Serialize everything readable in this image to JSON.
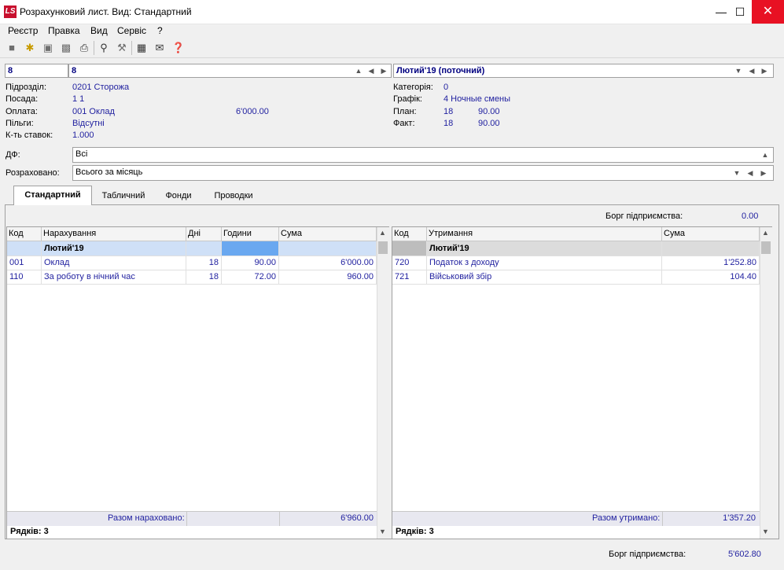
{
  "window": {
    "title": "Розрахунковий лист. Вид: Стандартний",
    "logo": "LS"
  },
  "menu": [
    "Реєстр",
    "Правка",
    "Вид",
    "Сервіс",
    "?"
  ],
  "toolbar_icons": [
    "folder-icon",
    "new-doc-icon",
    "copy-icon",
    "delete-icon",
    "print-icon",
    "search-icon",
    "wrench-icon",
    "calculator-icon",
    "mail-icon",
    "help-icon"
  ],
  "header": {
    "tab_number": "8",
    "employee": "8",
    "period": "Лютий'19 (поточний)"
  },
  "info_left": [
    {
      "label": "Підрозділ:",
      "value": "0201  Сторожа",
      "extra": ""
    },
    {
      "label": "Посада:",
      "value": "1  1",
      "extra": ""
    },
    {
      "label": "Оплата:",
      "value": "001 Оклад",
      "extra": "6'000.00"
    },
    {
      "label": "Пільги:",
      "value": "Відсутні",
      "extra": ""
    },
    {
      "label": "К-ть ставок:",
      "value": "1.000",
      "extra": ""
    }
  ],
  "info_right": [
    {
      "label": "Категорія:",
      "v1": "0",
      "v2": ""
    },
    {
      "label": "Графік:",
      "v1": "4  Ночные смены",
      "v2": ""
    },
    {
      "label": "План:",
      "v1": "18",
      "v2": "90.00"
    },
    {
      "label": "Факт:",
      "v1": "18",
      "v2": "90.00"
    }
  ],
  "df": {
    "label": "ДФ:",
    "value": "Всі"
  },
  "calculated": {
    "label": "Розраховано:",
    "value": "Всього за місяць"
  },
  "tabs": [
    "Стандартний",
    "Табличний",
    "Фонди",
    "Проводки"
  ],
  "debt_top": {
    "label": "Борг підприємства:",
    "value": "0.00"
  },
  "accruals": {
    "columns": [
      "Код",
      "Нарахування",
      "Дні",
      "Години",
      "Сума"
    ],
    "group": "Лютий'19",
    "rows": [
      {
        "code": "001",
        "name": "Оклад",
        "days": "18",
        "hours": "90.00",
        "sum": "6'000.00"
      },
      {
        "code": "110",
        "name": "За роботу в нічний час",
        "days": "18",
        "hours": "72.00",
        "sum": "960.00"
      }
    ],
    "total_label": "Разом нараховано:",
    "total_value": "6'960.00",
    "rows_count": "Рядків: 3"
  },
  "deductions": {
    "columns": [
      "Код",
      "Утримання",
      "Сума"
    ],
    "group": "Лютий'19",
    "rows": [
      {
        "code": "720",
        "name": "Податок з доходу",
        "sum": "1'252.80"
      },
      {
        "code": "721",
        "name": "Військовий збір",
        "sum": "104.40"
      }
    ],
    "total_label": "Разом утримано:",
    "total_value": "1'357.20",
    "rows_count": "Рядків: 3"
  },
  "debt_bottom": {
    "label": "Борг підприємства:",
    "value": "5'602.80"
  }
}
